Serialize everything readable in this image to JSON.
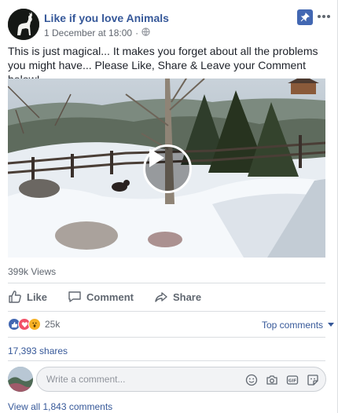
{
  "post": {
    "page_name": "Like if you love Animals",
    "timestamp": "1 December at 18:00",
    "separator": "·",
    "privacy_icon": "globe-icon",
    "text": "This is just magical... It makes you forget about all the problems you might have... Please Like, Share & Leave your Comment below!"
  },
  "video": {
    "views": "399k Views",
    "play_icon": "play-icon"
  },
  "actions": {
    "like": "Like",
    "comment": "Comment",
    "share": "Share"
  },
  "reactions": {
    "count": "25k",
    "types": [
      "like",
      "love",
      "wow"
    ],
    "top_comments": "Top comments"
  },
  "shares": "17,393 shares",
  "comment_input": {
    "placeholder": "Write a comment..."
  },
  "view_all_comments": "View all 1,843 comments",
  "colors": {
    "link": "#365899",
    "accent": "#4267b2",
    "text": "#1d2129",
    "muted": "#606770",
    "love": "#f25268",
    "wow": "#f7b125"
  }
}
